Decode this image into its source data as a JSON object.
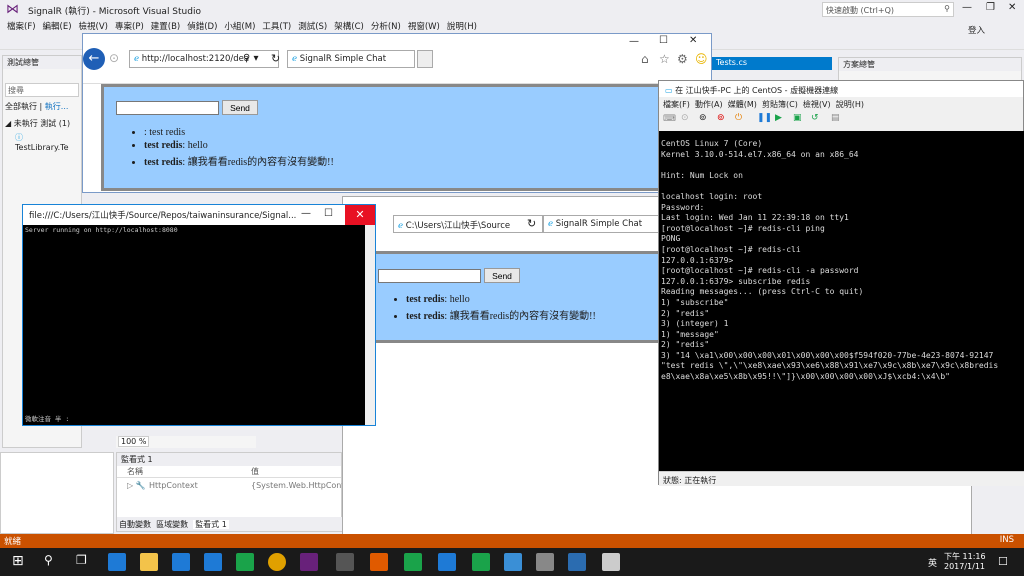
{
  "vs": {
    "title": "SignalR (執行) - Microsoft Visual Studio",
    "menu": [
      "檔案(F)",
      "編輯(E)",
      "檢視(V)",
      "專案(P)",
      "建置(B)",
      "偵錯(D)",
      "小組(M)",
      "工具(T)",
      "測試(S)",
      "架構(C)",
      "分析(N)",
      "視窗(W)",
      "說明(H)"
    ],
    "quick_launch": "快速啟動 (Ctrl+Q)",
    "login": "登入",
    "test_explorer": {
      "title": "測試總管",
      "search": "搜尋",
      "run_all": "全部執行",
      "run": "執行...",
      "group": "未執行 測試 (1)",
      "item": "TestLibrary.Te"
    },
    "tab_tests": "Tests.cs",
    "solution_explorer": "方案總管",
    "zoom": "100 %",
    "watch": {
      "title": "監看式 1",
      "col_name": "名稱",
      "col_value": "值",
      "row_name": "HttpContext",
      "row_value": "{System.Web.HttpContext"
    },
    "bottom_tabs": [
      "自動變數",
      "區域變數",
      "監看式 1"
    ],
    "status": "就緒",
    "ins": "INS"
  },
  "ie1": {
    "url": "http://localhost:2120/dea",
    "tab": "SignalR Simple Chat",
    "send": "Send",
    "messages": [
      {
        "name": "",
        "text": ": test redis"
      },
      {
        "name": "test redis",
        "text": ": hello"
      },
      {
        "name": "test redis",
        "text": ": 讓我看看redis的內容有沒有變動!!"
      }
    ]
  },
  "ie2": {
    "url": "C:\\Users\\江山快手\\Source",
    "tab": "SignalR Simple Chat",
    "send": "Send",
    "messages": [
      {
        "name": "test redis",
        "text": ": hello"
      },
      {
        "name": "test redis",
        "text": ": 讓我看看redis的內容有沒有變動!!"
      }
    ]
  },
  "cmd": {
    "title": "file:///C:/Users/江山快手/Source/Repos/taiwaninsurance/Signal...",
    "line1": "Server running on http://localhost:8080",
    "footer": "微軟注音 半 :"
  },
  "vm": {
    "title": "在 江山快手-PC 上的 CentOS - 虛擬機器連線",
    "menu": [
      "檔案(F)",
      "動作(A)",
      "媒體(M)",
      "剪貼簿(C)",
      "檢視(V)",
      "說明(H)"
    ],
    "console": "CentOS Linux 7 (Core)\nKernel 3.10.0-514.el7.x86_64 on an x86_64\n\nHint: Num Lock on\n\nlocalhost login: root\nPassword:\nLast login: Wed Jan 11 22:39:18 on tty1\n[root@localhost ~]# redis-cli ping\nPONG\n[root@localhost ~]# redis-cli\n127.0.0.1:6379>\n[root@localhost ~]# redis-cli -a password\n127.0.0.1:6379> subscribe redis\nReading messages... (press Ctrl-C to quit)\n1) \"subscribe\"\n2) \"redis\"\n3) (integer) 1\n1) \"message\"\n2) \"redis\"\n3) \"14 \\xa1\\x00\\x00\\x00\\x01\\x00\\x00\\x00$f594f020-77be-4e23-8074-92147\n\"test redis \\\",\\\"\\xe8\\xae\\x93\\xe6\\x88\\x91\\xe7\\x9c\\x8b\\xe7\\x9c\\x8bredis\ne8\\xae\\x8a\\xe5\\x8b\\x95!!\\\"]}\\x00\\x00\\x00\\x00\\xJ$\\xcb4:\\x4\\b\"",
    "status": "狀態: 正在執行"
  },
  "taskbar": {
    "time": "下午 11:16",
    "date": "2017/1/11",
    "ime": "英"
  }
}
